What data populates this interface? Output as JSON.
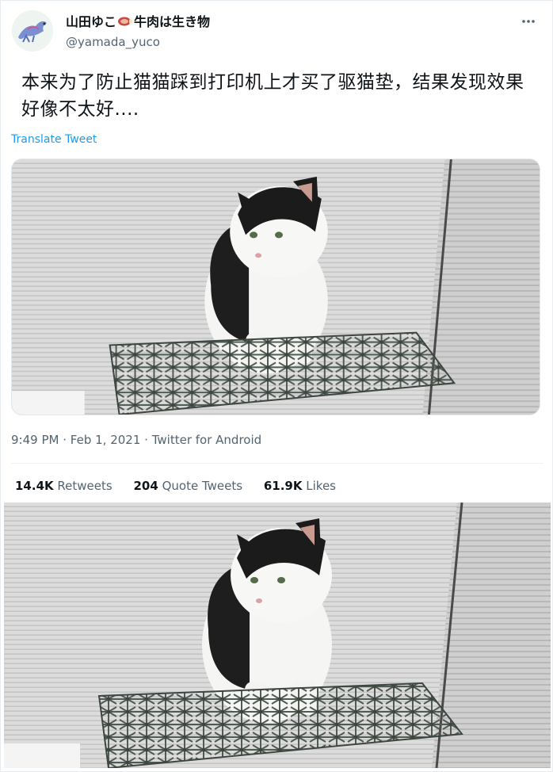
{
  "author": {
    "display_name_part1": "山田ゆこ",
    "display_name_part2": "牛肉は生き物",
    "handle": "@yamada_yuco",
    "avatar_icon": "blue-dragon-avatar-icon",
    "emoji_icon": "meat-emoji-icon"
  },
  "tweet": {
    "text": "本来为了防止猫猫踩到打印机上才买了驱猫垫，结果发现效果好像不太好....",
    "translate_label": "Translate Tweet"
  },
  "meta": {
    "time": "9:49 PM",
    "date": "Feb 1, 2021",
    "source": "Twitter for Android",
    "separator": "·"
  },
  "stats": {
    "retweets_count": "14.4K",
    "retweets_label": "Retweets",
    "quotes_count": "204",
    "quotes_label": "Quote Tweets",
    "likes_count": "61.9K",
    "likes_label": "Likes"
  },
  "colors": {
    "link_blue": "#1d9bf0",
    "secondary_text": "#536471",
    "primary_text": "#0f1419"
  }
}
